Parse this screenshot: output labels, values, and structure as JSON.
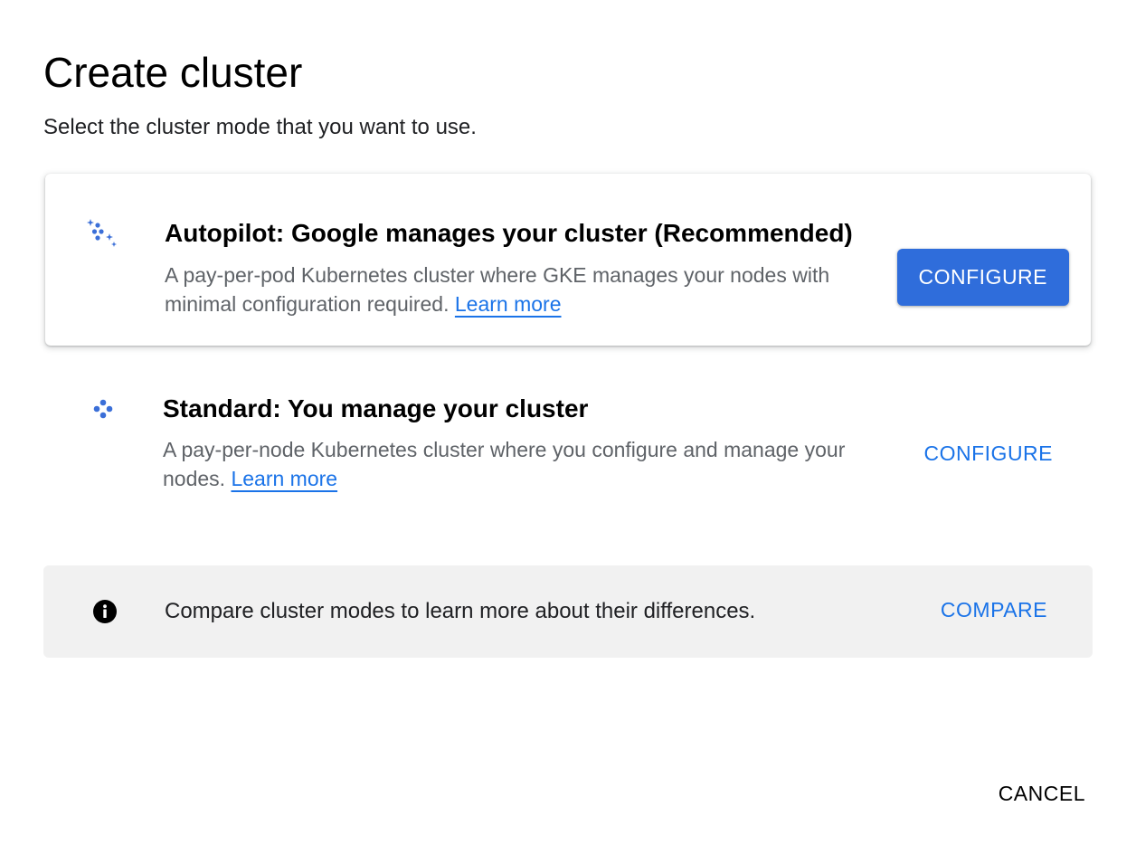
{
  "dialog": {
    "title": "Create cluster",
    "subtitle": "Select the cluster mode that you want to use."
  },
  "options": [
    {
      "icon": "autopilot-sparkle-icon",
      "title": "Autopilot: Google manages your cluster (Recommended)",
      "description": "A pay-per-pod Kubernetes cluster where GKE manages your nodes with minimal configuration required.",
      "link_label": "Learn more",
      "button_label": "CONFIGURE",
      "button_style": "filled"
    },
    {
      "icon": "standard-nodes-icon",
      "title": "Standard: You manage your cluster",
      "description": "A pay-per-node Kubernetes cluster where you configure and manage your nodes.",
      "link_label": "Learn more",
      "button_label": "CONFIGURE",
      "button_style": "text"
    }
  ],
  "banner": {
    "icon": "info-icon",
    "text": "Compare cluster modes to learn more about their differences.",
    "button_label": "COMPARE"
  },
  "footer": {
    "cancel_label": "CANCEL"
  },
  "colors": {
    "accent": "#1a73e8",
    "primary_button": "#2f6ddb",
    "banner_bg": "#f1f1f1",
    "secondary_text": "#5f6368"
  }
}
